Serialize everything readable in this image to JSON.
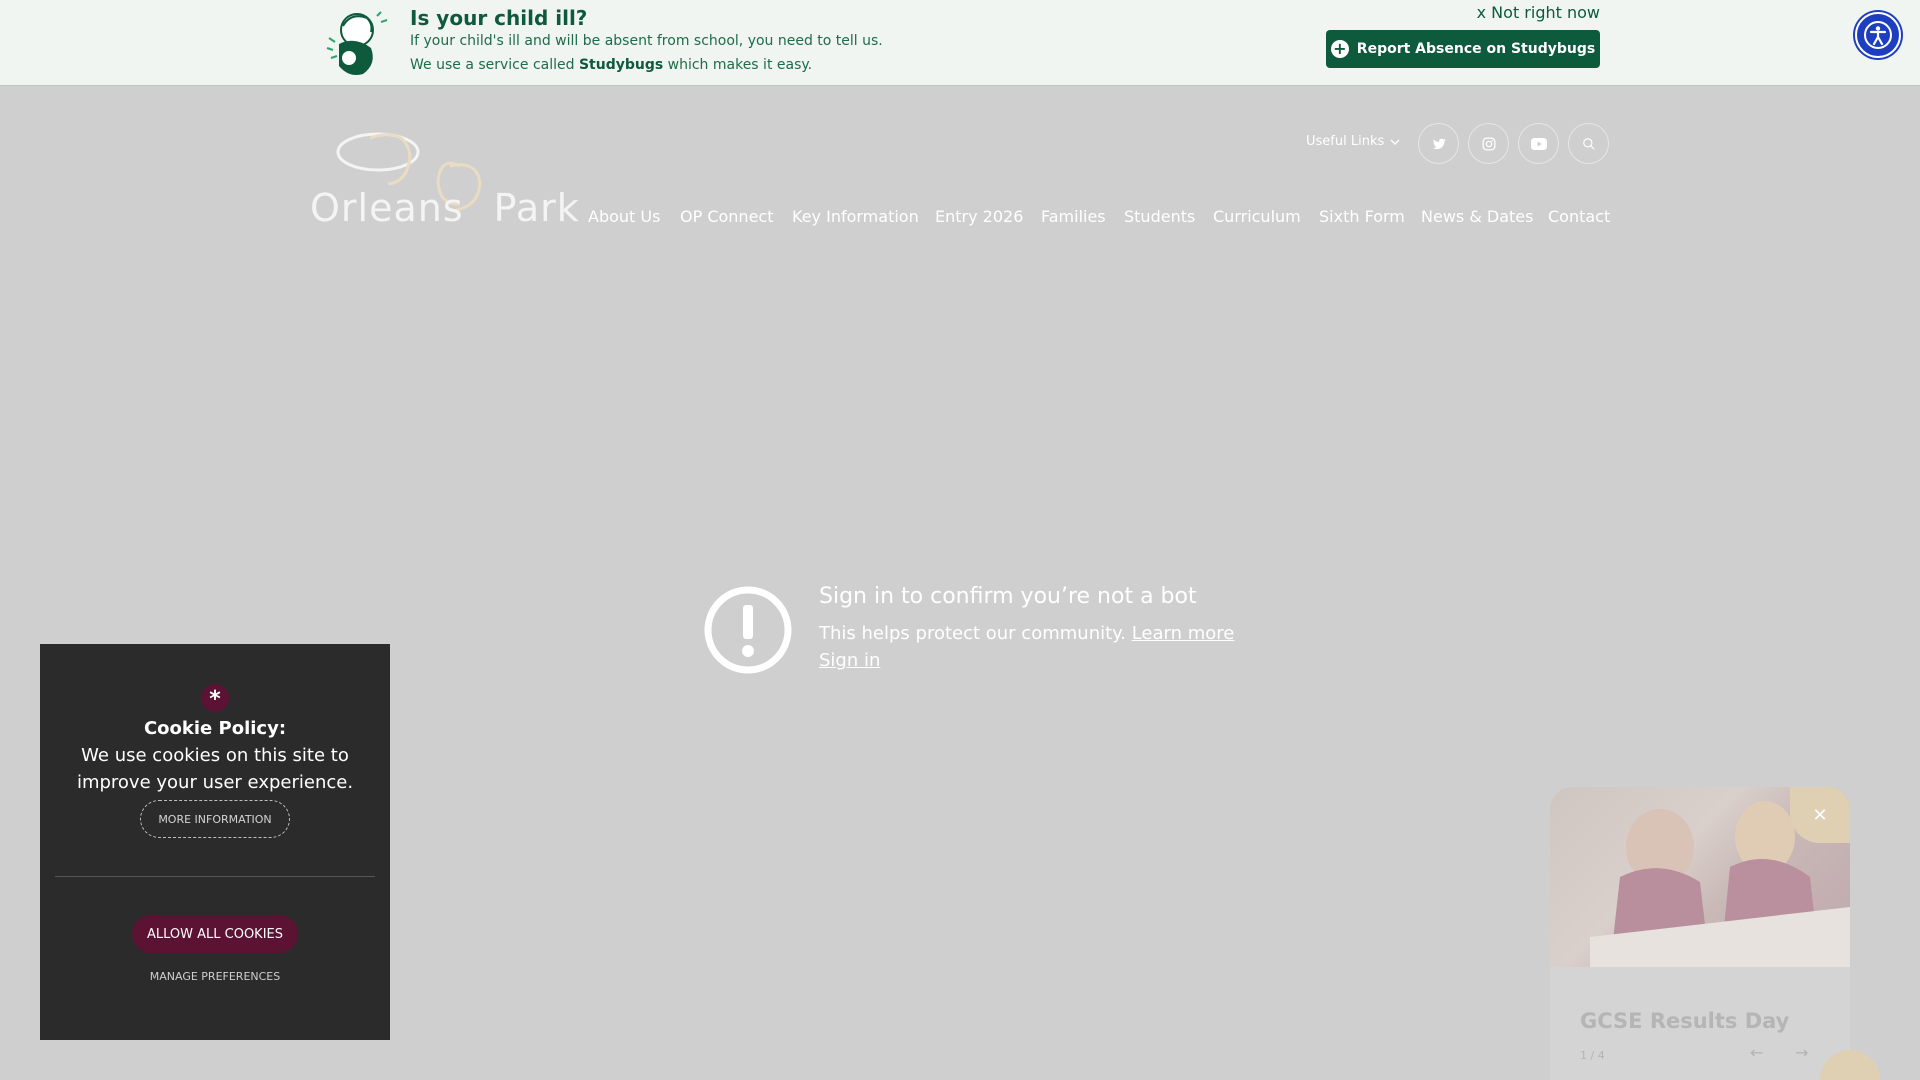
{
  "banner": {
    "title": "Is your child ill?",
    "line1": "If your child's ill and will be absent from school, you need to tell us.",
    "line2_pre": "We use a service called ",
    "line2_bold": "Studybugs",
    "line2_post": " which makes it easy.",
    "dismiss": "x Not right now",
    "report_button": "Report Absence on Studybugs"
  },
  "header": {
    "logo_word1": "Orleans",
    "logo_word2": "Park",
    "useful_links": "Useful Links",
    "social_icons": [
      "twitter-icon",
      "instagram-icon",
      "youtube-icon",
      "search-icon"
    ],
    "nav": [
      "About Us",
      "OP Connect",
      "Key Information",
      "Entry 2026",
      "Families",
      "Students",
      "Curriculum",
      "Sixth Form",
      "News & Dates",
      "Contact"
    ]
  },
  "bot_check": {
    "title": "Sign in to confirm you’re not a bot",
    "text": "This helps protect our community. ",
    "learn_more": "Learn more",
    "sign_in": "Sign in"
  },
  "cookie": {
    "icon_char": "*",
    "title": "Cookie Policy:",
    "text": "We use cookies on this site to improve your user experience.",
    "more_info": "MORE INFORMATION",
    "allow_all": "ALLOW ALL COOKIES",
    "manage": "MANAGE PREFERENCES"
  },
  "news_card": {
    "title": "GCSE Results Day",
    "counter": "1 / 4"
  },
  "colors": {
    "brand_green": "#0e5a3c",
    "brand_maroon": "#5b1233",
    "accent_gold": "#dfd0b4",
    "accessibility_blue": "#1d3fbf"
  }
}
